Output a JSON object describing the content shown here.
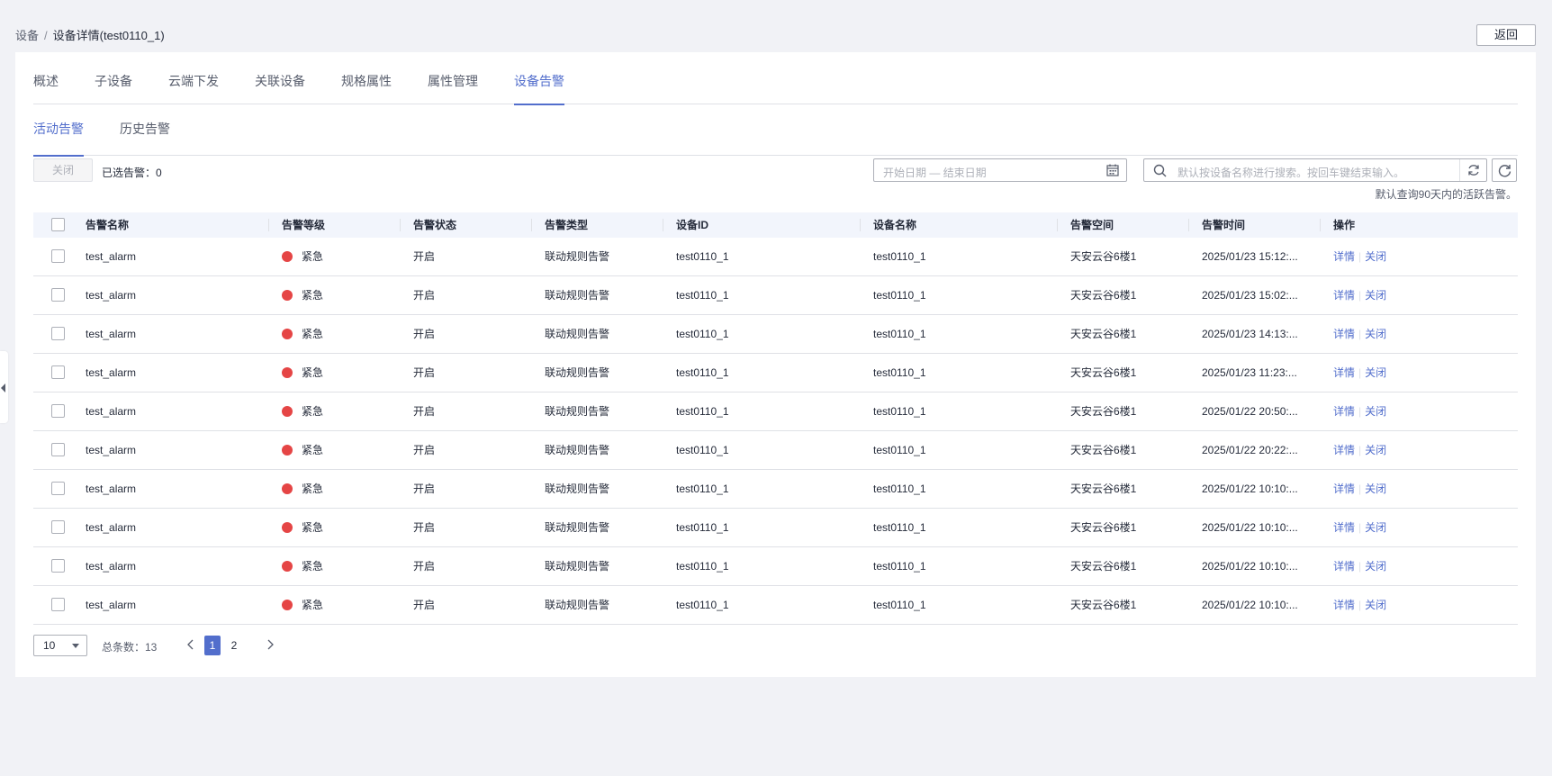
{
  "breadcrumb": {
    "root": "设备",
    "separator": "/",
    "current": "设备详情(test0110_1)"
  },
  "header": {
    "back_label": "返回"
  },
  "tabs": [
    {
      "label": "概述"
    },
    {
      "label": "子设备"
    },
    {
      "label": "云端下发"
    },
    {
      "label": "关联设备"
    },
    {
      "label": "规格属性"
    },
    {
      "label": "属性管理"
    },
    {
      "label": "设备告警"
    }
  ],
  "active_tab": "设备告警",
  "subtabs": [
    {
      "label": "活动告警"
    },
    {
      "label": "历史告警"
    }
  ],
  "toolbar": {
    "close_label": "关闭",
    "selected_label": "已选告警：0",
    "date_placeholder": "开始日期 — 结束日期",
    "search_placeholder": "默认按设备名称进行搜索。按回车键结束输入。",
    "hint": "默认查询90天内的活跃告警。"
  },
  "table": {
    "headers": {
      "name": "告警名称",
      "level": "告警等级",
      "status": "告警状态",
      "type": "告警类型",
      "device_id": "设备ID",
      "device_name": "设备名称",
      "space": "告警空间",
      "time": "告警时间",
      "ops": "操作"
    },
    "rows": [
      {
        "name": "test_alarm",
        "level": "紧急",
        "status": "开启",
        "type": "联动规则告警",
        "device_id": "test0110_1",
        "device_name": "test0110_1",
        "space": "天安云谷6楼1",
        "time": "2025/01/23 15:12:...",
        "detail": "详情",
        "close": "关闭"
      },
      {
        "name": "test_alarm",
        "level": "紧急",
        "status": "开启",
        "type": "联动规则告警",
        "device_id": "test0110_1",
        "device_name": "test0110_1",
        "space": "天安云谷6楼1",
        "time": "2025/01/23 15:02:...",
        "detail": "详情",
        "close": "关闭"
      },
      {
        "name": "test_alarm",
        "level": "紧急",
        "status": "开启",
        "type": "联动规则告警",
        "device_id": "test0110_1",
        "device_name": "test0110_1",
        "space": "天安云谷6楼1",
        "time": "2025/01/23 14:13:...",
        "detail": "详情",
        "close": "关闭"
      },
      {
        "name": "test_alarm",
        "level": "紧急",
        "status": "开启",
        "type": "联动规则告警",
        "device_id": "test0110_1",
        "device_name": "test0110_1",
        "space": "天安云谷6楼1",
        "time": "2025/01/23 11:23:...",
        "detail": "详情",
        "close": "关闭"
      },
      {
        "name": "test_alarm",
        "level": "紧急",
        "status": "开启",
        "type": "联动规则告警",
        "device_id": "test0110_1",
        "device_name": "test0110_1",
        "space": "天安云谷6楼1",
        "time": "2025/01/22 20:50:...",
        "detail": "详情",
        "close": "关闭"
      },
      {
        "name": "test_alarm",
        "level": "紧急",
        "status": "开启",
        "type": "联动规则告警",
        "device_id": "test0110_1",
        "device_name": "test0110_1",
        "space": "天安云谷6楼1",
        "time": "2025/01/22 20:22:...",
        "detail": "详情",
        "close": "关闭"
      },
      {
        "name": "test_alarm",
        "level": "紧急",
        "status": "开启",
        "type": "联动规则告警",
        "device_id": "test0110_1",
        "device_name": "test0110_1",
        "space": "天安云谷6楼1",
        "time": "2025/01/22 10:10:...",
        "detail": "详情",
        "close": "关闭"
      },
      {
        "name": "test_alarm",
        "level": "紧急",
        "status": "开启",
        "type": "联动规则告警",
        "device_id": "test0110_1",
        "device_name": "test0110_1",
        "space": "天安云谷6楼1",
        "time": "2025/01/22 10:10:...",
        "detail": "详情",
        "close": "关闭"
      },
      {
        "name": "test_alarm",
        "level": "紧急",
        "status": "开启",
        "type": "联动规则告警",
        "device_id": "test0110_1",
        "device_name": "test0110_1",
        "space": "天安云谷6楼1",
        "time": "2025/01/22 10:10:...",
        "detail": "详情",
        "close": "关闭"
      },
      {
        "name": "test_alarm",
        "level": "紧急",
        "status": "开启",
        "type": "联动规则告警",
        "device_id": "test0110_1",
        "device_name": "test0110_1",
        "space": "天安云谷6楼1",
        "time": "2025/01/22 10:10:...",
        "detail": "详情",
        "close": "关闭"
      }
    ]
  },
  "pagination": {
    "page_size": "10",
    "total_label": "总条数：13",
    "pages": [
      "1",
      "2"
    ],
    "current_page": "1"
  },
  "colors": {
    "accent": "#526ecc",
    "urgent": "#e54545"
  }
}
